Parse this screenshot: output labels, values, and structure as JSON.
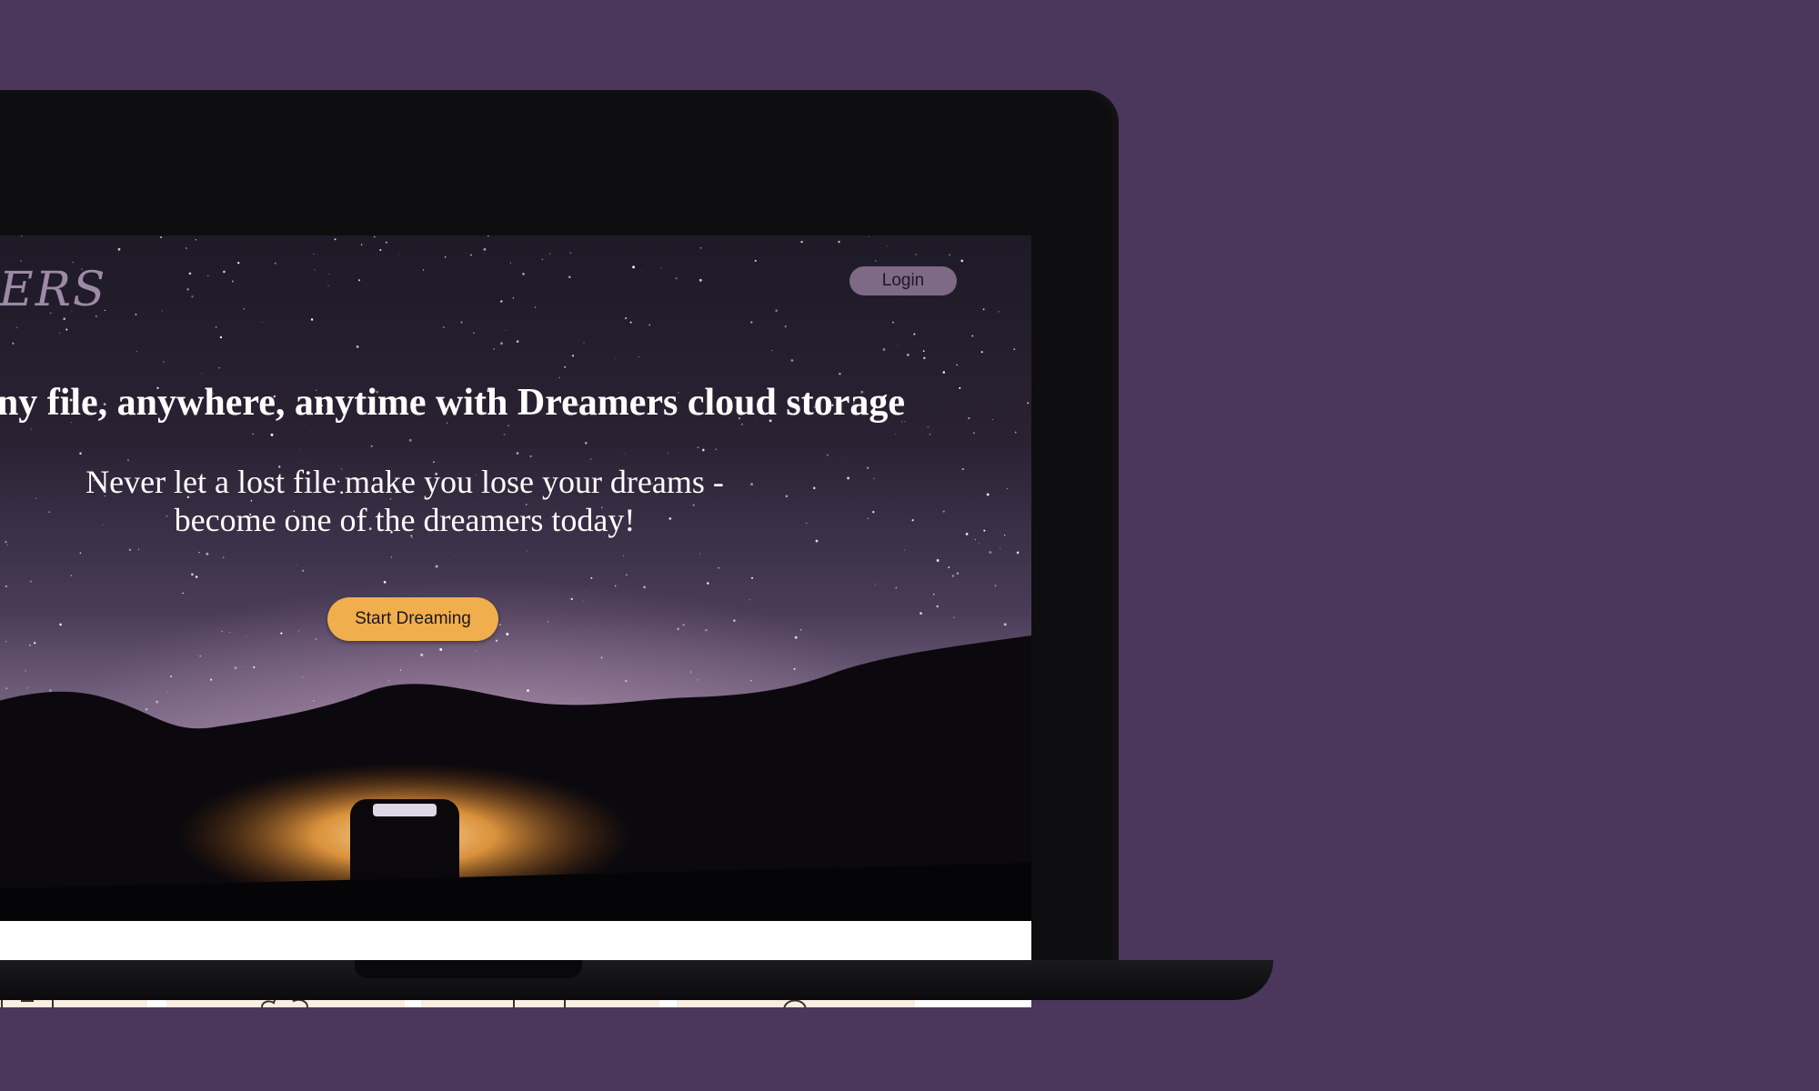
{
  "brand": {
    "logo_text": "AMERS"
  },
  "header": {
    "login_label": "Login"
  },
  "hero": {
    "headline": "oad any file, anywhere, anytime with Dreamers cloud storage",
    "subline_line1": "Never let a lost file make you lose your dreams -",
    "subline_line2": "become one of the dreamers today!",
    "cta_label": "Start Dreaming"
  },
  "features": {
    "cards": [
      {
        "icon": "toolbox-icon"
      },
      {
        "icon": "cloud-icon"
      },
      {
        "icon": "keyboard-icon"
      },
      {
        "icon": "lock-icon"
      }
    ]
  },
  "colors": {
    "background": "#4a375b",
    "accent": "#f0ae4c",
    "login_button": "#7e6a86",
    "card_background": "#fbeede"
  }
}
